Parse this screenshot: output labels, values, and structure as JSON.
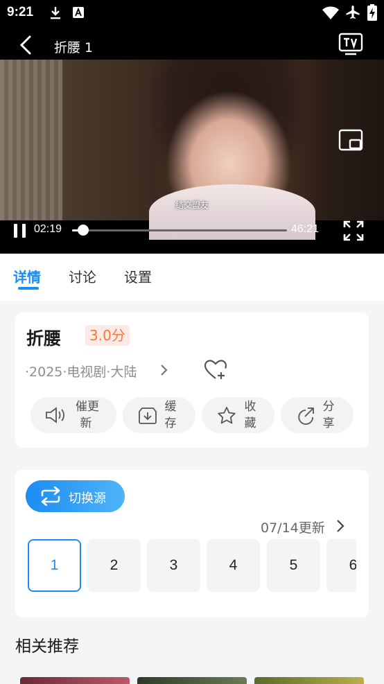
{
  "status_bar": {
    "time": "9:21",
    "icons": [
      "download-icon",
      "a-notification-icon",
      "wifi-icon",
      "airplane-mode-icon",
      "battery-charging-icon"
    ]
  },
  "header": {
    "back_icon": "chevron-left-icon",
    "title": "折腰 1",
    "tv_cast_icon": "tv-cast-icon"
  },
  "player": {
    "subtitle": "结交盟友",
    "current_time": "02:19",
    "duration": "46:21",
    "progress": 0.05,
    "playing": true,
    "icons": [
      "pause-icon",
      "pip-icon",
      "fullscreen-icon"
    ]
  },
  "tabs": [
    {
      "label": "详情",
      "active": true
    },
    {
      "label": "讨论",
      "active": false
    },
    {
      "label": "设置",
      "active": false
    }
  ],
  "show": {
    "title": "折腰",
    "score": "3.0分",
    "meta": "·2025·电视剧·大陆",
    "favorite_add_icon": "heart-plus-icon"
  },
  "actions": [
    {
      "label_line1": "催更",
      "label_line2": "新",
      "icon": "speaker-icon"
    },
    {
      "label_line1": "缓",
      "label_line2": "存",
      "icon": "download-box-icon"
    },
    {
      "label_line1": "收",
      "label_line2": "藏",
      "icon": "star-icon"
    },
    {
      "label_line1": "分",
      "label_line2": "享",
      "icon": "share-icon"
    }
  ],
  "source": {
    "switch_label": "切换源",
    "update_text": "07/14更新",
    "episodes": [
      "1",
      "2",
      "3",
      "4",
      "5",
      "6"
    ],
    "selected_episode": "1"
  },
  "recommend": {
    "title": "相关推荐"
  },
  "colors": {
    "accent": "#1b8cf2",
    "score_text": "#f47b3b",
    "score_bg": "#fde9e6",
    "page_bg": "#f4f5f7"
  }
}
